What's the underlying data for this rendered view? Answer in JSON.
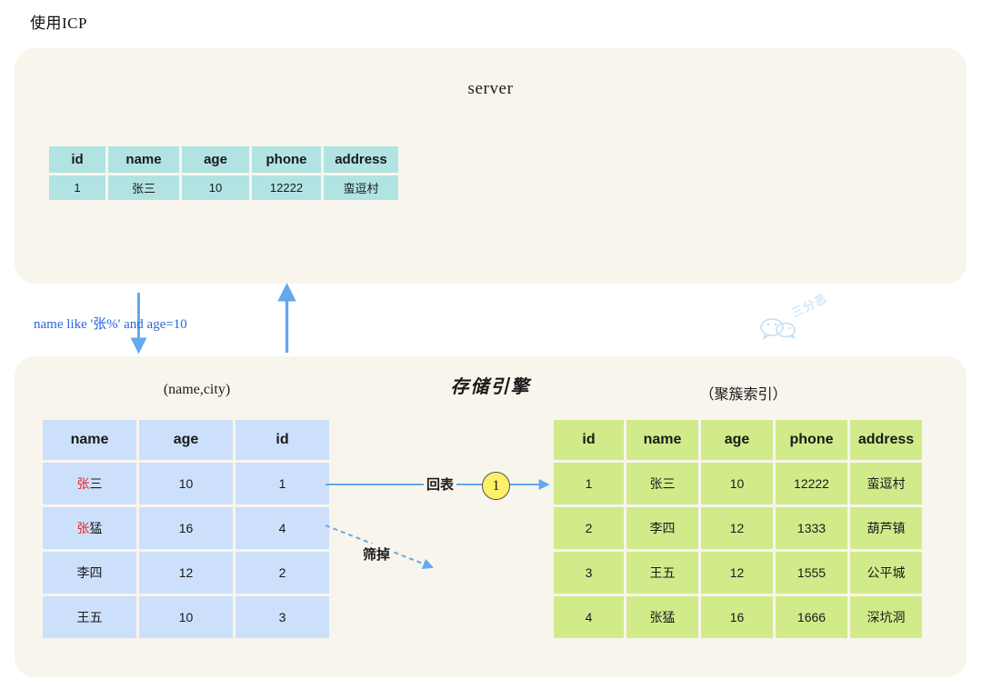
{
  "page": {
    "title": "使用ICP"
  },
  "server_panel": {
    "label": "server",
    "table": {
      "headers": [
        "id",
        "name",
        "age",
        "phone",
        "address"
      ],
      "rows": [
        [
          "1",
          "张三",
          "10",
          "12222",
          "蛮逗村"
        ]
      ]
    }
  },
  "engine_panel": {
    "label": "存储引擎",
    "index_table": {
      "caption": "(name,city)",
      "headers": [
        "name",
        "age",
        "id"
      ],
      "rows": [
        [
          {
            "text": "张",
            "color": "red"
          },
          {
            "text": "三",
            "color": "black"
          },
          {
            "text": "10",
            "color": "red"
          },
          {
            "text": "1",
            "color": "red"
          }
        ],
        [
          {
            "text": "张",
            "color": "red"
          },
          {
            "text": "猛",
            "color": "black"
          },
          {
            "text": "16",
            "color": "red"
          },
          {
            "text": "4",
            "color": "blue"
          }
        ],
        [
          {
            "text": "李四",
            "color": "black"
          },
          {
            "text": "",
            "color": "black"
          },
          {
            "text": "12",
            "color": "black"
          },
          {
            "text": "2",
            "color": "black"
          }
        ],
        [
          {
            "text": "王五",
            "color": "black"
          },
          {
            "text": "",
            "color": "black"
          },
          {
            "text": "10",
            "color": "black"
          },
          {
            "text": "3",
            "color": "black"
          }
        ]
      ]
    },
    "clustered_table": {
      "caption": "（聚簇索引）",
      "headers": [
        "id",
        "name",
        "age",
        "phone",
        "address"
      ],
      "rows": [
        [
          "1",
          "张三",
          "10",
          "12222",
          "蛮逗村"
        ],
        [
          "2",
          "李四",
          "12",
          "1333",
          "葫芦镇"
        ],
        [
          "3",
          "王五",
          "12",
          "1555",
          "公平城"
        ],
        [
          "4",
          "张猛",
          "16",
          "1666",
          "深坑洞"
        ]
      ],
      "highlight_cell": {
        "row": 0,
        "col": 0,
        "color": "red"
      }
    }
  },
  "flow": {
    "query_label": "name like '张%' and age=10",
    "back_table_label": "回表",
    "step_badge": "1",
    "filter_label": "筛掉"
  },
  "watermark": {
    "text": "三分恶"
  },
  "colors": {
    "panel_bg": "#f8f5ec",
    "server_table": "#b2e3e3",
    "index_table": "#cce0fb",
    "clustered_table": "#d1eb8b",
    "arrow_blue": "#62a9ee",
    "query_text": "#2c66d8",
    "badge_yellow": "#fdf06a",
    "highlight_red": "#ee2222",
    "highlight_blue": "#2222dd"
  }
}
